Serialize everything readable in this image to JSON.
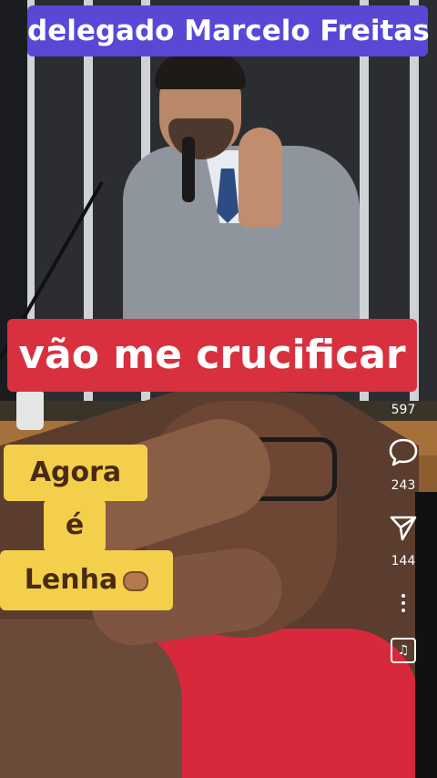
{
  "captions": {
    "title": "delegado Marcelo Freitas",
    "main": "vão me crucificar",
    "line1": "Agora",
    "line2": "é",
    "line3": "Lenha"
  },
  "rail": {
    "likes": "597",
    "comments": "243",
    "shares": "144",
    "music_glyph": "♫"
  },
  "colors": {
    "title_bg": "#5a47d6",
    "main_bg": "#d8303f",
    "yellow_bg": "#f3cf4b"
  }
}
